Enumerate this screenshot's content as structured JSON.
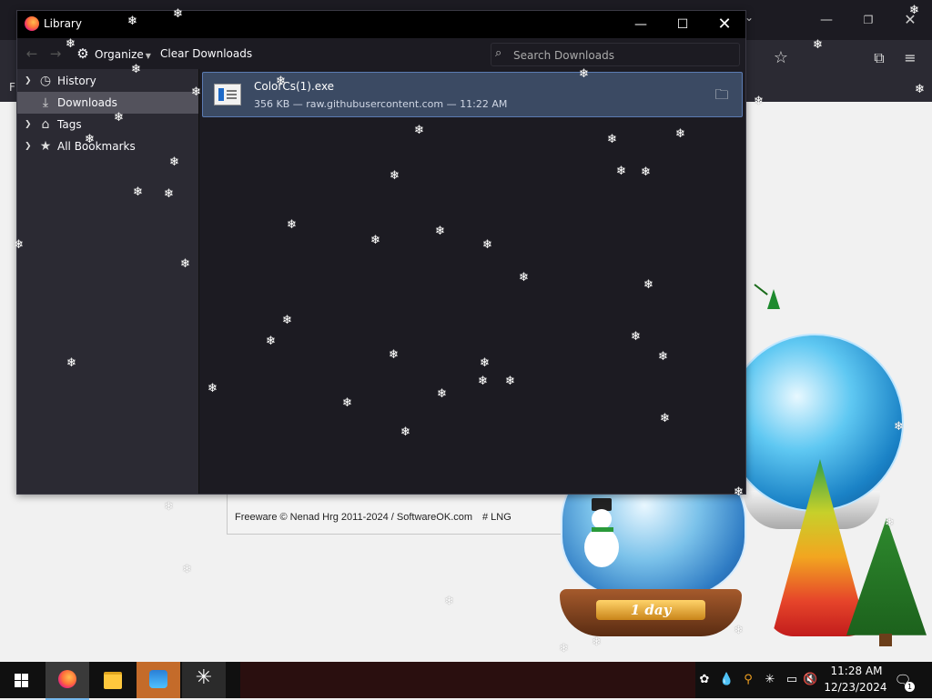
{
  "library": {
    "title": "Library",
    "toolbar": {
      "back_icon": "back-arrow-icon",
      "forward_icon": "forward-arrow-icon",
      "organize_label": "Organize",
      "clear_label": "Clear Downloads",
      "search_placeholder": "Search Downloads"
    },
    "sidebar": {
      "items": [
        {
          "label": "History",
          "icon": "clock-icon",
          "expandable": true,
          "selected": false
        },
        {
          "label": "Downloads",
          "icon": "download-icon",
          "expandable": false,
          "selected": true
        },
        {
          "label": "Tags",
          "icon": "tag-icon",
          "expandable": true,
          "selected": false
        },
        {
          "label": "All Bookmarks",
          "icon": "star-icon",
          "expandable": true,
          "selected": false
        }
      ]
    },
    "downloads": [
      {
        "name": "ColorCs(1).exe",
        "meta": "356 KB — raw.githubusercontent.com — 11:22 AM",
        "icon": "exe-file-icon"
      }
    ]
  },
  "background_browser": {
    "bookmark_letter": "F"
  },
  "app_panel": {
    "footer_text": "Freeware © Nenad Hrg 2011-2024 / SoftwareOK.com",
    "lng_label": "# LNG"
  },
  "decor": {
    "globe_plate_text": "1 day"
  },
  "taskbar": {
    "time": "11:28 AM",
    "date": "12/23/2024",
    "notification_count": "1"
  },
  "colors": {
    "window_bg": "#1c1b22",
    "sidebar_bg": "#2b2a33",
    "selected_item": "#3b4a63",
    "accent_border": "#5b7bb2",
    "taskbar_bg": "#101010"
  }
}
